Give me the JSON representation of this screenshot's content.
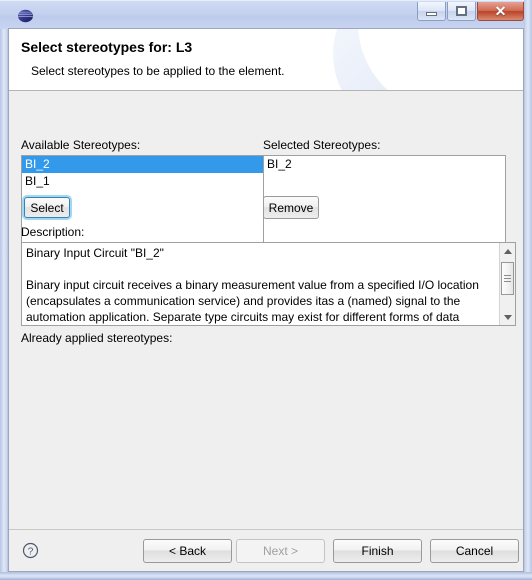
{
  "window": {
    "app_icon": "eclipse-globe-icon",
    "controls": {
      "minimize": "minimize-icon",
      "maximize": "restore-icon",
      "close": "✕"
    }
  },
  "header": {
    "title": "Select stereotypes for: L3",
    "subtitle": "Select stereotypes to be applied to the element."
  },
  "available": {
    "label": "Available Stereotypes:",
    "items": [
      {
        "text": "BI_2",
        "selected": true
      },
      {
        "text": "BI_1",
        "selected": false
      }
    ],
    "button": "Select"
  },
  "selected": {
    "label": "Selected Stereotypes:",
    "items": [
      {
        "text": "BI_2",
        "selected": false
      }
    ],
    "button": "Remove"
  },
  "description": {
    "label": "Description:",
    "text": "Binary Input Circuit \"BI_2\"\n\nBinary input circuit receives a binary measurement value from a specified I/O location (encapsulates a communication service) and provides itas a (named) signal to the automation application. Separate type circuits may exist for different forms of data"
  },
  "already_applied": {
    "label": "Already applied stereotypes:",
    "items": []
  },
  "footer": {
    "help": "?",
    "buttons": [
      {
        "label": "< Back",
        "disabled": false
      },
      {
        "label": "Next >",
        "disabled": true
      },
      {
        "label": "Finish",
        "disabled": false
      },
      {
        "label": "Cancel",
        "disabled": false
      }
    ]
  },
  "colors": {
    "selection": "#3399ea",
    "dialog_bg": "#efefef",
    "titlebar": "#c4d1ef",
    "close_button": "#bb4228",
    "focus_glow": "#9fd8f5"
  }
}
